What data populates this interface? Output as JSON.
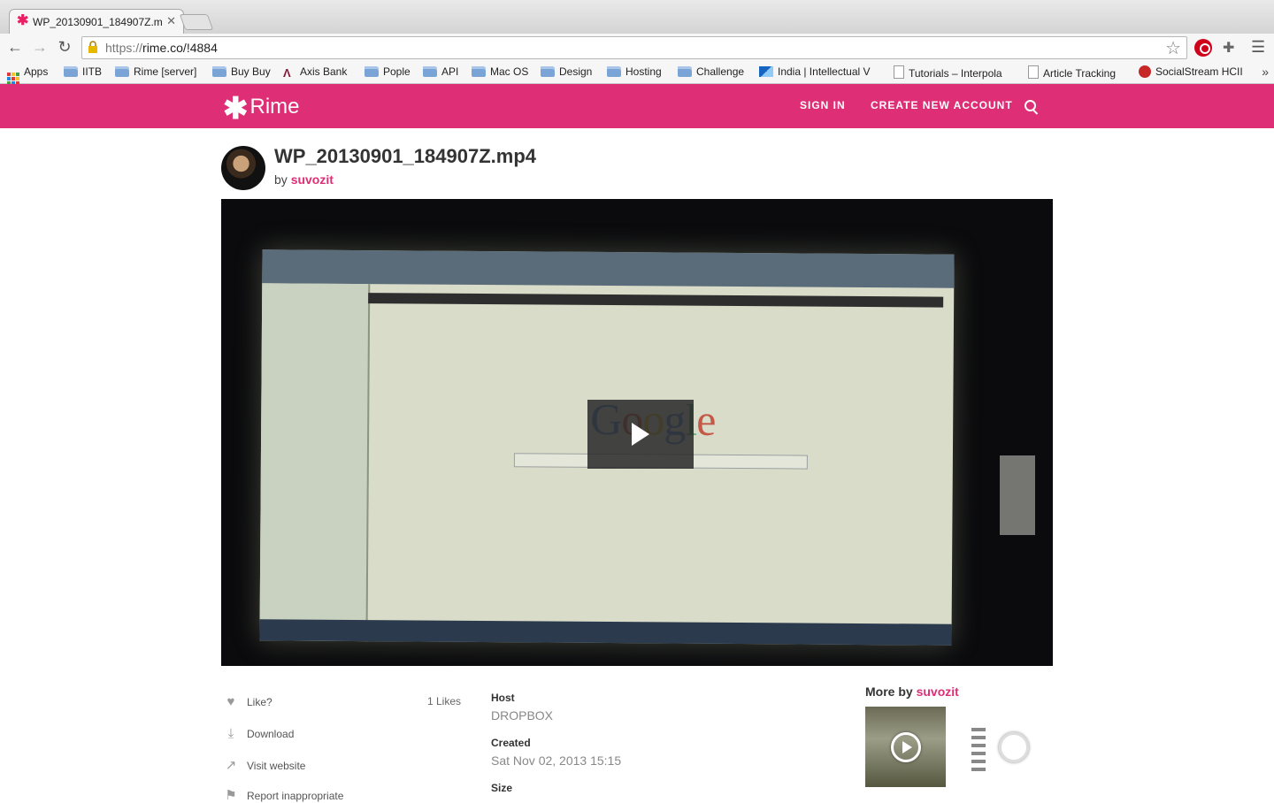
{
  "browser": {
    "tab_title": "WP_20130901_184907Z.m",
    "url_scheme": "https://",
    "url_rest": "rime.co/!4884",
    "bookmarks": [
      "Apps",
      "IITB",
      "Rime [server]",
      "Buy Buy",
      "Axis Bank",
      "Pople",
      "API",
      "Mac OS",
      "Design",
      "Hosting",
      "Challenge",
      "India | Intellectual V",
      "Tutorials – Interpola",
      "Article Tracking",
      "SocialStream HCII"
    ]
  },
  "site": {
    "logo_text": "Rime",
    "nav": {
      "sign_in": "SIGN IN",
      "create_account": "CREATE NEW ACCOUNT"
    },
    "accent": "#de2e76"
  },
  "media": {
    "title": "WP_20130901_184907Z.mp4",
    "by_label": "by",
    "author": "suvozit"
  },
  "actions": {
    "like": "Like?",
    "likes_count": "1 Likes",
    "download": "Download",
    "visit": "Visit website",
    "report": "Report inappropriate"
  },
  "meta": {
    "host_label": "Host",
    "host_value": "DROPBOX",
    "created_label": "Created",
    "created_value": "Sat Nov 02, 2013 15:15",
    "size_label": "Size"
  },
  "more_by": {
    "label": "More by",
    "author": "suvozit"
  }
}
